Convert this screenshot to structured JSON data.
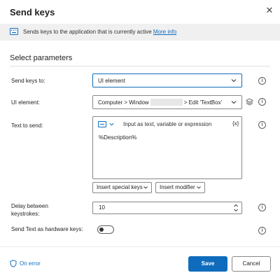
{
  "dialog": {
    "title": "Send keys",
    "close_icon": "close-icon"
  },
  "banner": {
    "text": "Sends keys to the application that is currently active",
    "link": "More info",
    "icon": "keyboard-icon"
  },
  "section": {
    "title": "Select parameters"
  },
  "fields": {
    "send_keys_to": {
      "label": "Send keys to:",
      "value": "UI element"
    },
    "ui_element": {
      "label": "UI element:",
      "value_prefix": "Computer > Window",
      "value_suffix": "> Edit 'TextBox'"
    },
    "text_to_send": {
      "label": "Text to send:",
      "hint": "Input as text, variable or expression",
      "fx": "{x}",
      "value": "%Description%"
    },
    "insert_special_keys": "Insert special keys",
    "insert_modifier": "Insert modifier",
    "delay": {
      "label": "Delay between keystrokes:",
      "value": "10"
    },
    "hardware_keys": {
      "label": "Send Text as hardware keys:",
      "enabled": false
    }
  },
  "footer": {
    "on_error": "On error",
    "save": "Save",
    "cancel": "Cancel"
  },
  "colors": {
    "accent": "#0f6cbd",
    "banner_bg": "#f0f0f0"
  }
}
